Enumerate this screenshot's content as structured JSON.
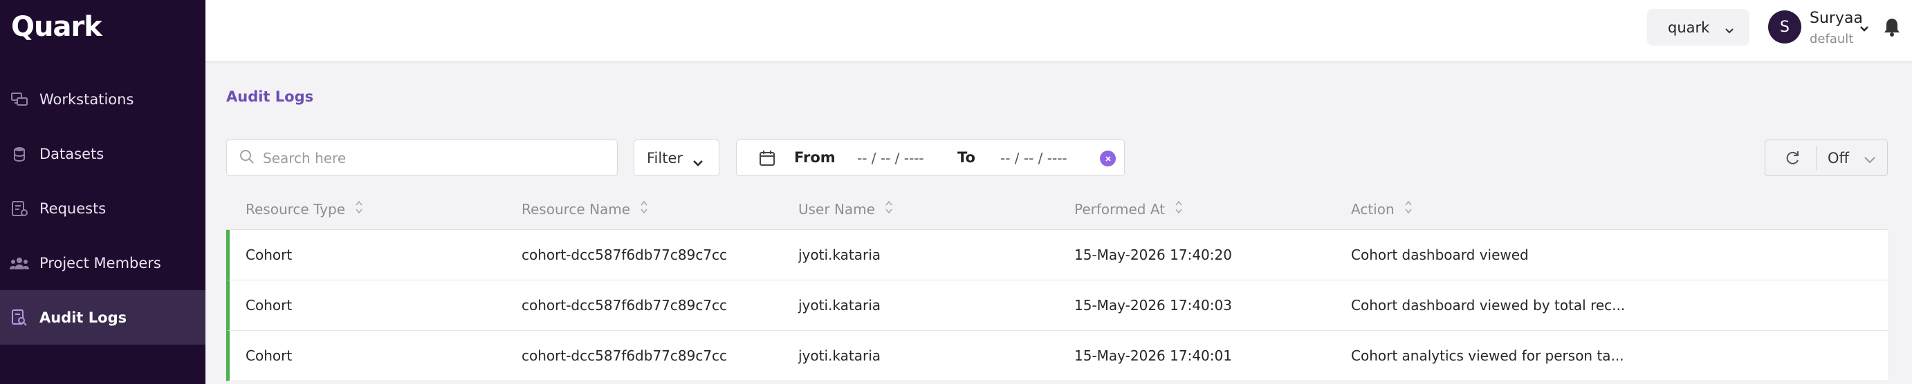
{
  "app": {
    "logo": "Quark"
  },
  "sidebar": {
    "items": [
      {
        "label": "Workstations",
        "icon": "workstation-icon"
      },
      {
        "label": "Datasets",
        "icon": "database-icon"
      },
      {
        "label": "Requests",
        "icon": "requests-icon"
      },
      {
        "label": "Project Members",
        "icon": "members-icon"
      },
      {
        "label": "Audit Logs",
        "icon": "audit-icon",
        "active": true
      }
    ]
  },
  "header": {
    "project": "quark",
    "user": {
      "initial": "S",
      "name": "Suryaa",
      "org": "default"
    }
  },
  "page": {
    "breadcrumb": "Audit Logs"
  },
  "toolbar": {
    "search_placeholder": "Search here",
    "filter_label": "Filter",
    "from_label": "From",
    "from_value": "-- / -- / ----",
    "to_label": "To",
    "to_value": "-- / -- / ----",
    "refresh_value": "Off"
  },
  "table": {
    "columns": [
      "Resource Type",
      "Resource Name",
      "User Name",
      "Performed At",
      "Action"
    ],
    "rows": [
      [
        "Cohort",
        "cohort-dcc587f6db77c89c7cc",
        "jyoti.kataria",
        "15-May-2026 17:40:20",
        "Cohort dashboard viewed"
      ],
      [
        "Cohort",
        "cohort-dcc587f6db77c89c7cc",
        "jyoti.kataria",
        "15-May-2026 17:40:03",
        "Cohort dashboard viewed by total rec..."
      ],
      [
        "Cohort",
        "cohort-dcc587f6db77c89c7cc",
        "jyoti.kataria",
        "15-May-2026 17:40:01",
        "Cohort analytics viewed for person ta..."
      ]
    ]
  },
  "colors": {
    "sidebar_bg": "#1e0c2f",
    "accent": "#6e4db5",
    "row_marker": "#4caf50"
  }
}
